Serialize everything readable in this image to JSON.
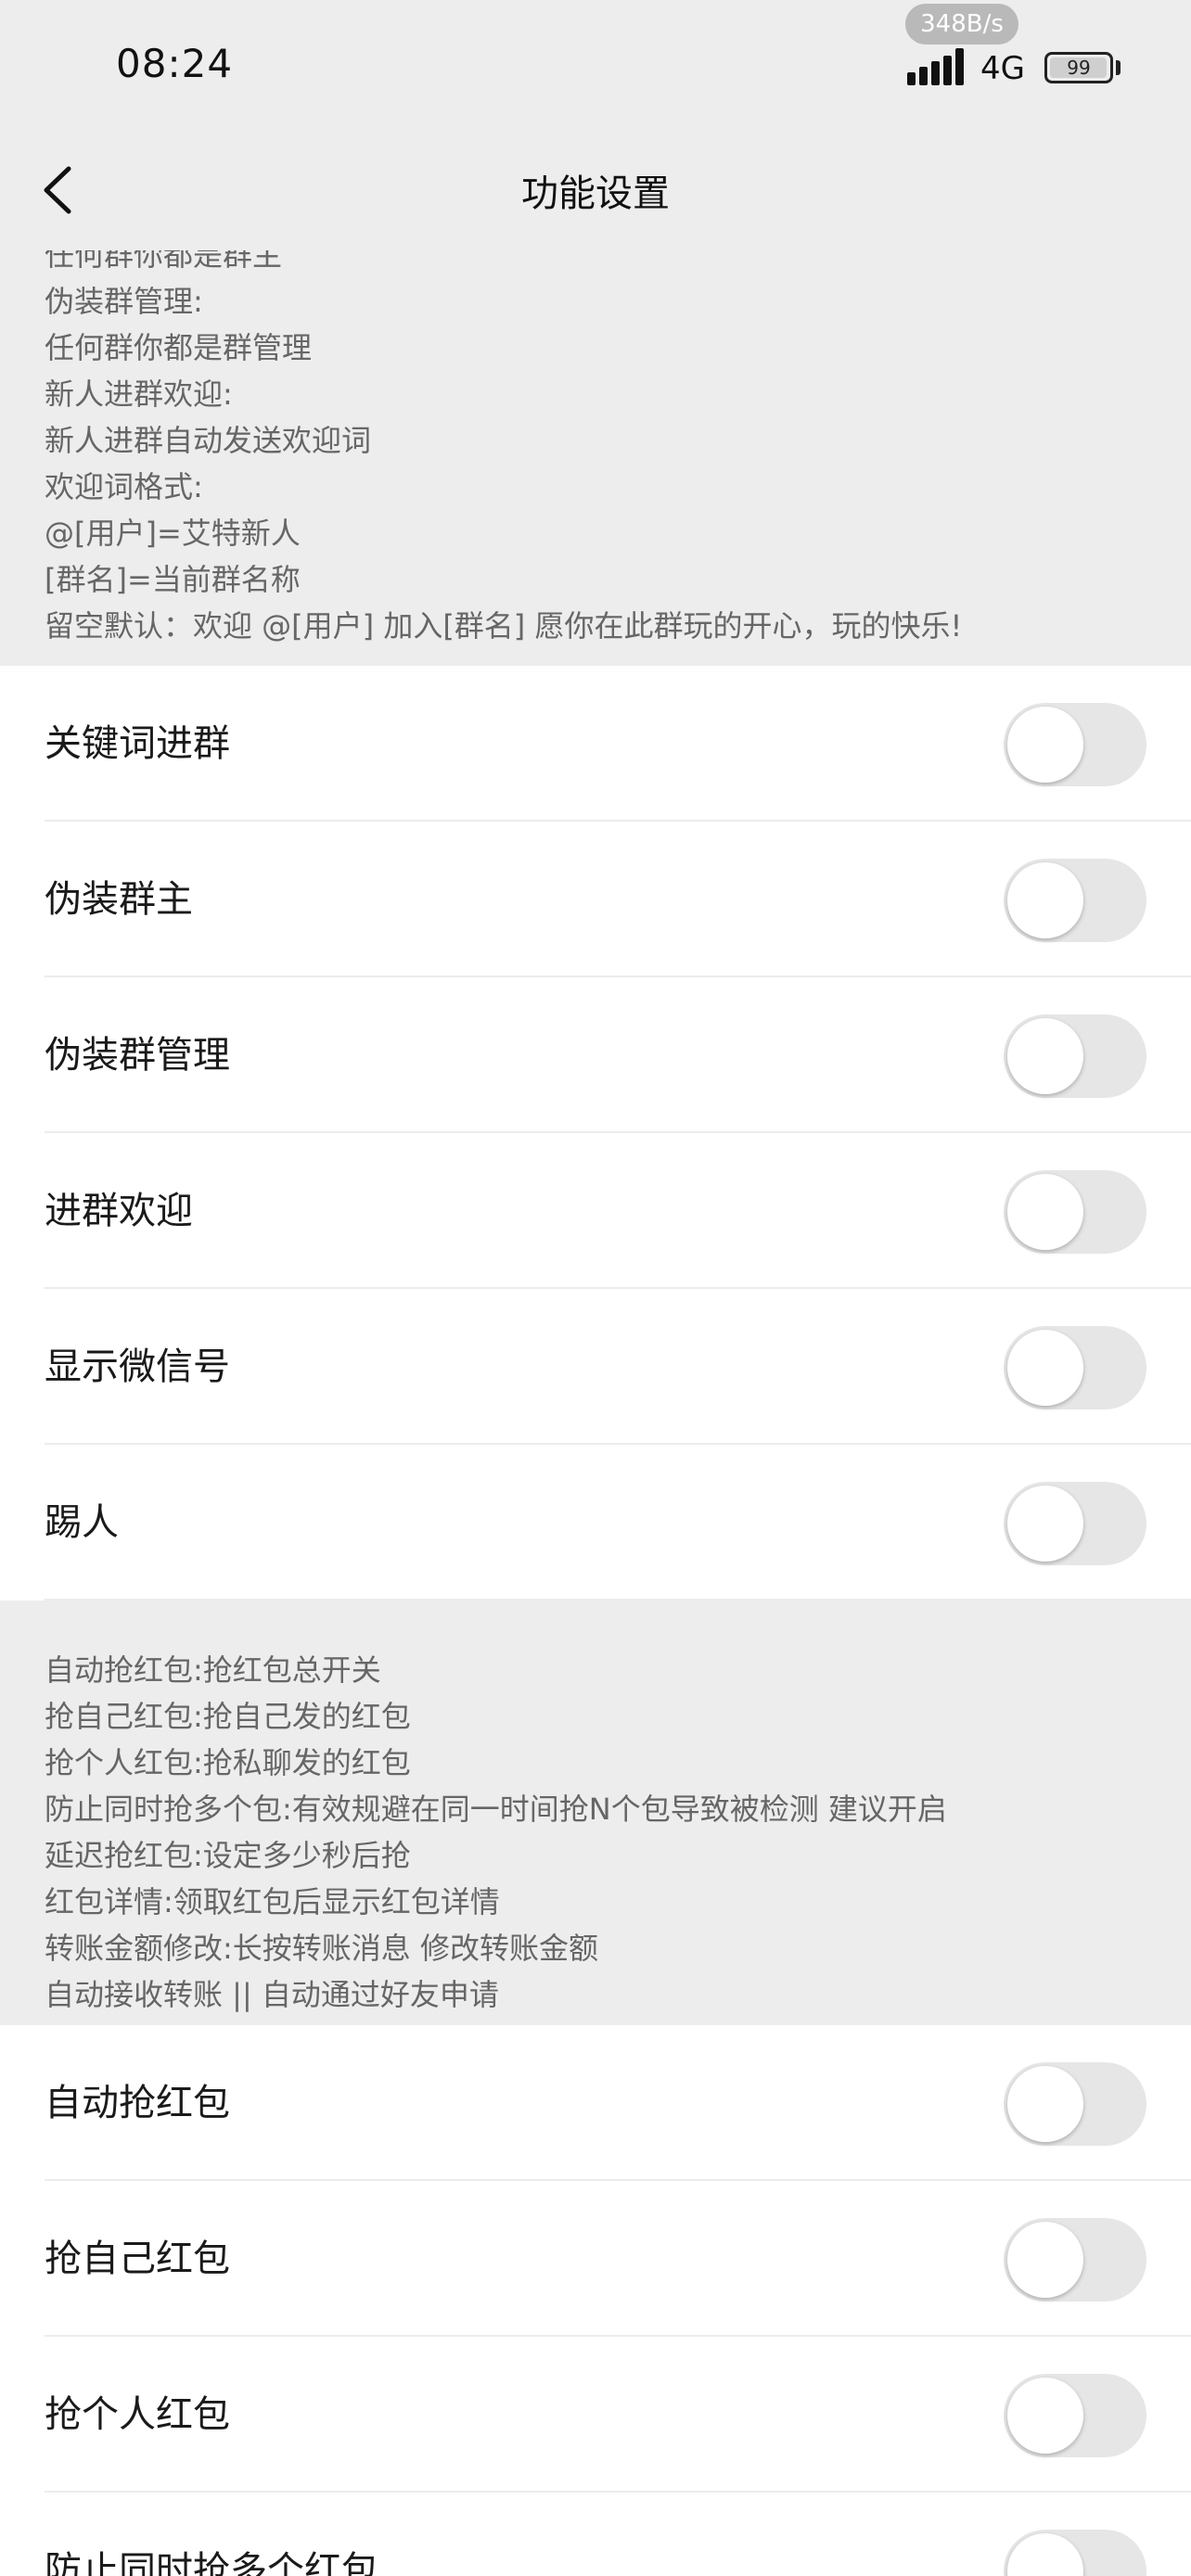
{
  "status_bar": {
    "time": "08:24",
    "net_speed": "348B/s",
    "network_type": "4G",
    "battery": "99",
    "battery_level_percent": 99
  },
  "nav": {
    "title": "功能设置",
    "back_icon": "chevron-left-icon"
  },
  "group_desc": {
    "lines": [
      "任何群你都是群主",
      "伪装群管理:",
      "任何群你都是群管理",
      "新人进群欢迎:",
      "新人进群自动发送欢迎词",
      "欢迎词格式:",
      "@[用户]=艾特新人",
      "[群名]=当前群名称",
      "留空默认：欢迎 @[用户] 加入[群名] 愿你在此群玩的开心，玩的快乐!"
    ]
  },
  "group_settings": [
    {
      "label": "关键词进群",
      "enabled": false
    },
    {
      "label": "伪装群主",
      "enabled": false
    },
    {
      "label": "伪装群管理",
      "enabled": false
    },
    {
      "label": "进群欢迎",
      "enabled": false
    },
    {
      "label": "显示微信号",
      "enabled": false
    },
    {
      "label": "踢人",
      "enabled": false
    }
  ],
  "redpacket_desc": {
    "lines": [
      "自动抢红包:抢红包总开关",
      "抢自己红包:抢自己发的红包",
      "抢个人红包:抢私聊发的红包",
      "防止同时抢多个包:有效规避在同一时间抢N个包导致被检测 建议开启",
      "延迟抢红包:设定多少秒后抢",
      "红包详情:领取红包后显示红包详情",
      "转账金额修改:长按转账消息 修改转账金额",
      "自动接收转账 || 自动通过好友申请"
    ]
  },
  "redpacket_settings": [
    {
      "label": "自动抢红包",
      "enabled": false
    },
    {
      "label": "抢自己红包",
      "enabled": false
    },
    {
      "label": "抢个人红包",
      "enabled": false
    },
    {
      "label": "防止同时抢多个红包",
      "enabled": false
    }
  ]
}
